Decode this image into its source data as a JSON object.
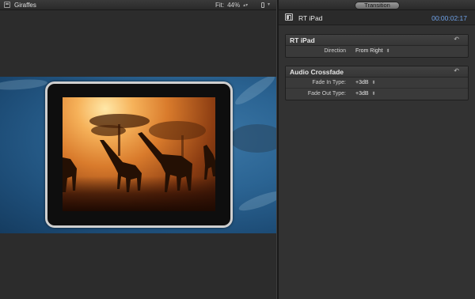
{
  "viewer": {
    "clip_name": "Giraffes",
    "fit_label": "Fit:",
    "zoom": "44%"
  },
  "inspector": {
    "tab": "Transition",
    "title": "RT iPad",
    "timecode": "00:00:02:17",
    "sections": [
      {
        "title": "RT iPad",
        "reset_icon": "reset-arrow-icon",
        "params": [
          {
            "label": "Direction",
            "value": "From Right"
          }
        ]
      },
      {
        "title": "Audio Crossfade",
        "reset_icon": "reset-arrow-icon",
        "params": [
          {
            "label": "Fade In Type:",
            "value": "+3dB"
          },
          {
            "label": "Fade Out Type:",
            "value": "+3dB"
          }
        ]
      }
    ]
  },
  "colors": {
    "background": "#2b2b2b",
    "timecode": "#6fa2e8",
    "ocean_blue": "#2b6493"
  }
}
